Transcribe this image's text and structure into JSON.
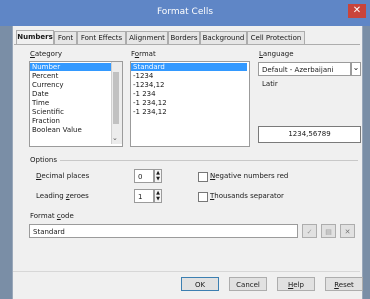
{
  "window": {
    "title": "Format Cells",
    "close": "✕"
  },
  "tabs": [
    "Numbers",
    "Font",
    "Font Effects",
    "Alignment",
    "Borders",
    "Background",
    "Cell Protection"
  ],
  "category": {
    "label_u": "C",
    "label_rest": "ategory",
    "items": [
      "Number",
      "Percent",
      "Currency",
      "Date",
      "Time",
      "Scientific",
      "Fraction",
      "Boolean Value"
    ],
    "selected": "Number"
  },
  "format": {
    "label_pre": "F",
    "label_u": "o",
    "label_rest": "rmat",
    "items": [
      "Standard",
      "-1234",
      "-1234,12",
      "-1 234",
      "-1 234,12",
      "-1 234,12"
    ],
    "selected": "Standard"
  },
  "language": {
    "label_u": "L",
    "label_rest": "anguage",
    "value": "Default - Azerbaijani Latir",
    "preview": "1234,56789"
  },
  "options": {
    "heading": "Options",
    "decimal_label_u": "D",
    "decimal_label_rest": "ecimal places",
    "decimal_value": "0",
    "leading_label_pre": "Leading ",
    "leading_label_u": "z",
    "leading_label_rest": "eroes",
    "leading_value": "1",
    "negative_u": "N",
    "negative_rest": "egative numbers red",
    "thousands_u": "T",
    "thousands_rest": "housands separator"
  },
  "format_code": {
    "label_pre": "Format ",
    "label_u": "c",
    "label_rest": "ode",
    "value": "Standard"
  },
  "buttons": {
    "ok": "OK",
    "cancel": "Cancel",
    "help_u": "H",
    "help_rest": "elp",
    "reset_u": "R",
    "reset_rest": "eset"
  },
  "colors": {
    "titlebar": "#5f86c6",
    "selection": "#3399ff",
    "close": "#c9443b"
  }
}
